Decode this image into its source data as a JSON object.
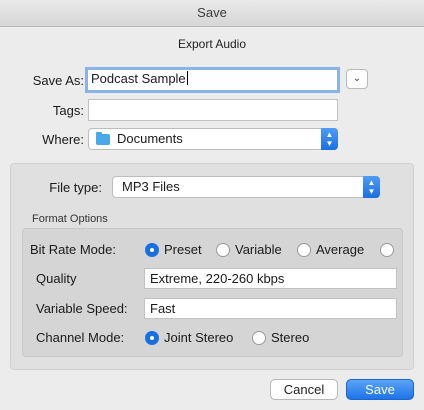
{
  "window": {
    "title": "Save"
  },
  "dialog": {
    "subtitle": "Export Audio"
  },
  "save_as": {
    "label": "Save As:",
    "value": "Podcast Sample"
  },
  "tags": {
    "label": "Tags:",
    "value": ""
  },
  "where": {
    "label": "Where:",
    "value": "Documents",
    "icon": "folder-icon"
  },
  "disclosure": {
    "icon": "chevron-down-icon"
  },
  "file_type": {
    "label": "File type:",
    "value": "MP3 Files"
  },
  "format_options": {
    "caption": "Format Options",
    "bit_rate_mode": {
      "label": "Bit Rate Mode:",
      "options": [
        "Preset",
        "Variable",
        "Average",
        ""
      ],
      "selected": "Preset"
    },
    "quality": {
      "label": "Quality",
      "value": "Extreme, 220-260 kbps"
    },
    "variable_speed": {
      "label": "Variable Speed:",
      "value": "Fast"
    },
    "channel_mode": {
      "label": "Channel Mode:",
      "options": [
        "Joint Stereo",
        "Stereo"
      ],
      "selected": "Joint Stereo"
    }
  },
  "buttons": {
    "cancel": "Cancel",
    "save": "Save"
  },
  "colors": {
    "accent": "#1a6fe0",
    "focus_ring": "#8ab3ea",
    "background": "#ececec"
  }
}
